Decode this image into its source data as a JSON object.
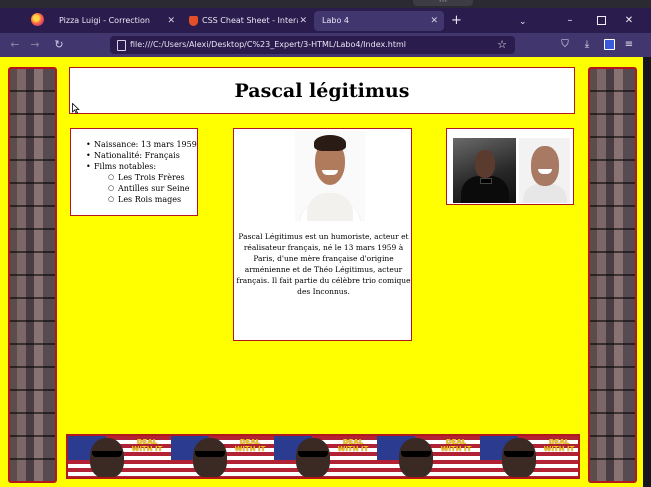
{
  "browser": {
    "tabs": [
      {
        "label": "Pizza Luigi - Correction",
        "active": false
      },
      {
        "label": "CSS Cheat Sheet - Interactive, n",
        "active": false
      },
      {
        "label": "Labo 4",
        "active": true
      }
    ],
    "url": "file:///C:/Users/Alexi/Desktop/C%23_Expert/3-HTML/Labo4/Index.html",
    "icons": {
      "firefox": "firefox-icon",
      "new_tab": "+",
      "tab_list": "⌄",
      "close": "✕",
      "minimize": "–",
      "back": "←",
      "forward": "→",
      "reload": "↻",
      "bookmark": "☆",
      "pocket": "⛉",
      "download": "⤓",
      "menu": "≡"
    }
  },
  "page": {
    "title": "Pascal légitimus",
    "info": [
      "Naissance: 13 mars 1959",
      "Nationalité: Français",
      "Films notables:"
    ],
    "films": [
      "Les Trois Frères",
      "Antilles sur Seine",
      "Les Rois mages"
    ],
    "bio": "Pascal Légitimus est un humoriste, acteur et réalisateur français, né le 13 mars 1959 à Paris, d'une mère française d'origine arménienne et de Théo Légitimus, acteur français. Il fait partie du célèbre trio comique des Inconnus.",
    "banner_text": "DEAL WITH IT",
    "colors": {
      "background": "#ffff00",
      "border": "#b3171c",
      "box": "#ffffff"
    }
  }
}
